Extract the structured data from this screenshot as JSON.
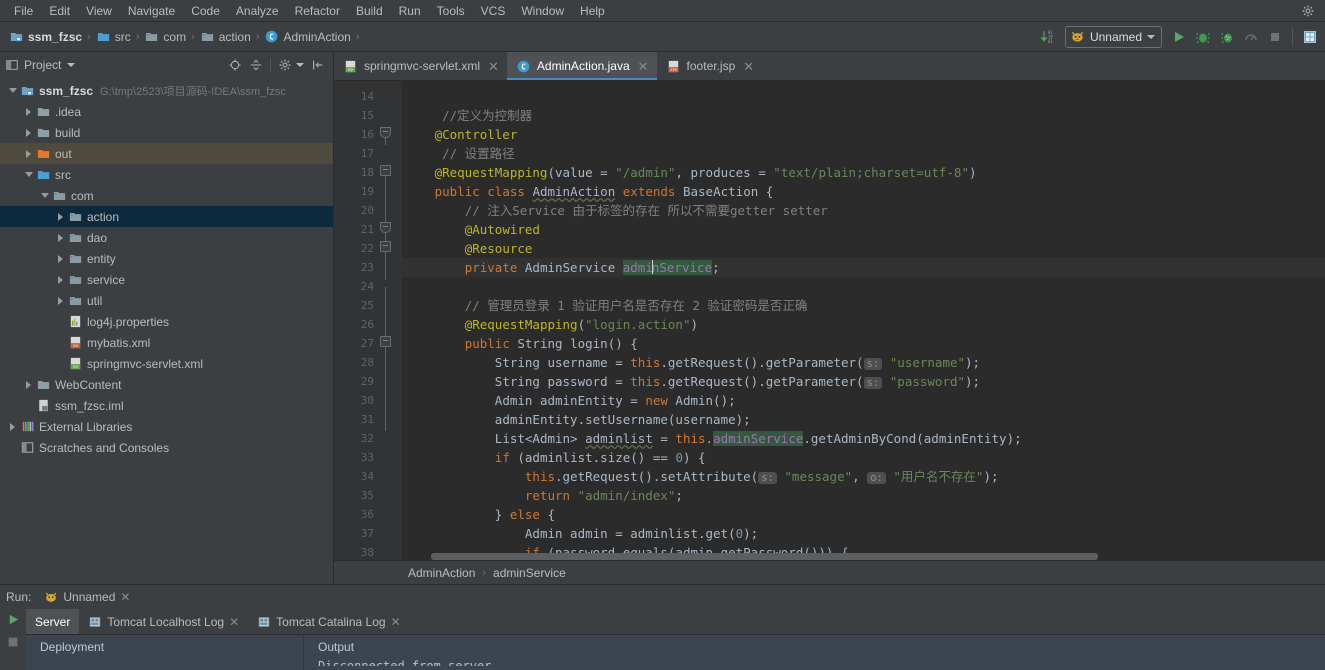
{
  "window": {
    "theme_bg": "#3c3f41",
    "editor_bg": "#2b2b2b",
    "accent": "#4a88c7"
  },
  "menubar": {
    "items": [
      {
        "label": "File"
      },
      {
        "label": "Edit"
      },
      {
        "label": "View"
      },
      {
        "label": "Navigate"
      },
      {
        "label": "Code"
      },
      {
        "label": "Analyze"
      },
      {
        "label": "Refactor"
      },
      {
        "label": "Build"
      },
      {
        "label": "Run"
      },
      {
        "label": "Tools"
      },
      {
        "label": "VCS"
      },
      {
        "label": "Window"
      },
      {
        "label": "Help"
      }
    ]
  },
  "navbar": {
    "crumbs": [
      {
        "label": "ssm_fzsc",
        "icon": "module-icon"
      },
      {
        "label": "src",
        "icon": "source-folder-icon"
      },
      {
        "label": "com",
        "icon": "package-folder-icon"
      },
      {
        "label": "action",
        "icon": "package-folder-icon"
      },
      {
        "label": "AdminAction",
        "icon": "java-class-icon"
      }
    ],
    "separator": "›",
    "run_config": {
      "label": "Unnamed",
      "icon": "tomcat-icon"
    },
    "buttons": [
      {
        "name": "updates-icon",
        "title": "Sync"
      },
      {
        "name": "run-icon",
        "title": "Run"
      },
      {
        "name": "debug-icon",
        "title": "Debug"
      },
      {
        "name": "run-coverage-icon",
        "title": "Run with Coverage"
      },
      {
        "name": "profile-icon",
        "title": "Profile"
      },
      {
        "name": "stop-icon",
        "title": "Stop"
      },
      {
        "name": "database-icon",
        "title": "Database"
      }
    ]
  },
  "project_panel": {
    "title": "Project",
    "tools": [
      {
        "name": "locate-icon"
      },
      {
        "name": "collapse-all-icon"
      },
      {
        "name": "settings-gear-icon"
      },
      {
        "name": "hide-panel-icon"
      }
    ],
    "tree": [
      {
        "label": "ssm_fzsc",
        "path": "G:\\tmp\\2523\\项目源码-IDEA\\ssm_fzsc",
        "indent": 0,
        "arrow": "down",
        "icon": "module-icon",
        "bold": true,
        "state": "normal"
      },
      {
        "label": ".idea",
        "indent": 1,
        "arrow": "right",
        "icon": "folder-icon",
        "state": "normal"
      },
      {
        "label": "build",
        "indent": 1,
        "arrow": "right",
        "icon": "folder-icon",
        "state": "normal"
      },
      {
        "label": "out",
        "indent": 1,
        "arrow": "right",
        "icon": "excluded-folder-icon",
        "state": "highlight"
      },
      {
        "label": "src",
        "indent": 1,
        "arrow": "down",
        "icon": "source-folder-icon",
        "state": "normal"
      },
      {
        "label": "com",
        "indent": 2,
        "arrow": "down",
        "icon": "package-folder-icon",
        "state": "normal"
      },
      {
        "label": "action",
        "indent": 3,
        "arrow": "right",
        "icon": "package-folder-icon",
        "state": "selected"
      },
      {
        "label": "dao",
        "indent": 3,
        "arrow": "right",
        "icon": "package-folder-icon",
        "state": "normal"
      },
      {
        "label": "entity",
        "indent": 3,
        "arrow": "right",
        "icon": "package-folder-icon",
        "state": "normal"
      },
      {
        "label": "service",
        "indent": 3,
        "arrow": "right",
        "icon": "package-folder-icon",
        "state": "normal"
      },
      {
        "label": "util",
        "indent": 3,
        "arrow": "right",
        "icon": "package-folder-icon",
        "state": "normal"
      },
      {
        "label": "log4j.properties",
        "indent": 3,
        "arrow": "none",
        "icon": "properties-file-icon",
        "state": "normal"
      },
      {
        "label": "mybatis.xml",
        "indent": 3,
        "arrow": "none",
        "icon": "xml-file-icon",
        "state": "normal"
      },
      {
        "label": "springmvc-servlet.xml",
        "indent": 3,
        "arrow": "none",
        "icon": "spring-xml-file-icon",
        "state": "normal"
      },
      {
        "label": "WebContent",
        "indent": 1,
        "arrow": "right",
        "icon": "folder-icon",
        "state": "normal"
      },
      {
        "label": "ssm_fzsc.iml",
        "indent": 1,
        "arrow": "none",
        "icon": "iml-file-icon",
        "state": "normal"
      },
      {
        "label": "External Libraries",
        "indent": 0,
        "arrow": "right",
        "icon": "libraries-icon",
        "state": "normal"
      },
      {
        "label": "Scratches and Consoles",
        "indent": 0,
        "arrow": "none",
        "icon": "scratches-icon",
        "state": "normal"
      }
    ]
  },
  "editor": {
    "tabs": [
      {
        "label": "springmvc-servlet.xml",
        "icon": "spring-xml-file-icon",
        "active": false,
        "closable": true
      },
      {
        "label": "AdminAction.java",
        "icon": "java-class-icon",
        "active": true,
        "closable": true
      },
      {
        "label": "footer.jsp",
        "icon": "jsp-file-icon",
        "active": false,
        "closable": true
      }
    ],
    "first_line_number": 14,
    "lines": [
      {
        "n": 14,
        "tokens": []
      },
      {
        "n": 15,
        "tokens": [
          {
            "t": "    ",
            "c": "id"
          },
          {
            "t": "//定义为控制器",
            "c": "cmt"
          }
        ]
      },
      {
        "n": 16,
        "tokens": [
          {
            "t": "   ",
            "c": "id"
          },
          {
            "t": "@Controller",
            "c": "ann"
          }
        ]
      },
      {
        "n": 17,
        "tokens": [
          {
            "t": "    ",
            "c": "id"
          },
          {
            "t": "// 设置路径",
            "c": "cmt"
          }
        ]
      },
      {
        "n": 18,
        "tokens": [
          {
            "t": "   ",
            "c": "id"
          },
          {
            "t": "@RequestMapping",
            "c": "ann"
          },
          {
            "t": "(",
            "c": "id"
          },
          {
            "t": "value",
            "c": "id"
          },
          {
            "t": " = ",
            "c": "id"
          },
          {
            "t": "\"/admin\"",
            "c": "str"
          },
          {
            "t": ", ",
            "c": "id"
          },
          {
            "t": "produces",
            "c": "id"
          },
          {
            "t": " = ",
            "c": "id"
          },
          {
            "t": "\"text/plain;charset=utf-8\"",
            "c": "str"
          },
          {
            "t": ")",
            "c": "id"
          }
        ]
      },
      {
        "n": 19,
        "tokens": [
          {
            "t": "   ",
            "c": "id"
          },
          {
            "t": "public",
            "c": "kw"
          },
          {
            "t": " ",
            "c": "id"
          },
          {
            "t": "class",
            "c": "kw"
          },
          {
            "t": " ",
            "c": "id"
          },
          {
            "t": "AdminAction",
            "c": "id wavy"
          },
          {
            "t": " ",
            "c": "id"
          },
          {
            "t": "extends",
            "c": "kw"
          },
          {
            "t": " ",
            "c": "id"
          },
          {
            "t": "BaseAction",
            "c": "id"
          },
          {
            "t": " {",
            "c": "id"
          }
        ]
      },
      {
        "n": 20,
        "tokens": [
          {
            "t": "       ",
            "c": "id"
          },
          {
            "t": "// 注入Service 由于标签的存在 所以不需要getter setter",
            "c": "cmt"
          }
        ]
      },
      {
        "n": 21,
        "tokens": [
          {
            "t": "       ",
            "c": "id"
          },
          {
            "t": "@Autowired",
            "c": "ann"
          }
        ]
      },
      {
        "n": 22,
        "tokens": [
          {
            "t": "       ",
            "c": "id"
          },
          {
            "t": "@Resource",
            "c": "ann"
          }
        ]
      },
      {
        "n": 23,
        "caret": true,
        "tokens": [
          {
            "t": "       ",
            "c": "id"
          },
          {
            "t": "private",
            "c": "kw"
          },
          {
            "t": " ",
            "c": "id"
          },
          {
            "t": "AdminService",
            "c": "id"
          },
          {
            "t": " ",
            "c": "id"
          },
          {
            "t": "adminService",
            "c": "fld hlg",
            "caret_after": 4
          },
          {
            "t": ";",
            "c": "id"
          }
        ]
      },
      {
        "n": 24,
        "tokens": []
      },
      {
        "n": 25,
        "tokens": [
          {
            "t": "       ",
            "c": "id"
          },
          {
            "t": "// 管理员登录 1 验证用户名是否存在 2 验证密码是否正确",
            "c": "cmt"
          }
        ]
      },
      {
        "n": 26,
        "tokens": [
          {
            "t": "       ",
            "c": "id"
          },
          {
            "t": "@RequestMapping",
            "c": "ann"
          },
          {
            "t": "(",
            "c": "id"
          },
          {
            "t": "\"login.action\"",
            "c": "str"
          },
          {
            "t": ")",
            "c": "id"
          }
        ]
      },
      {
        "n": 27,
        "tokens": [
          {
            "t": "       ",
            "c": "id"
          },
          {
            "t": "public",
            "c": "kw"
          },
          {
            "t": " ",
            "c": "id"
          },
          {
            "t": "String",
            "c": "id"
          },
          {
            "t": " ",
            "c": "id"
          },
          {
            "t": "login",
            "c": "id"
          },
          {
            "t": "() {",
            "c": "id"
          }
        ]
      },
      {
        "n": 28,
        "tokens": [
          {
            "t": "           ",
            "c": "id"
          },
          {
            "t": "String",
            "c": "id"
          },
          {
            "t": " username = ",
            "c": "id"
          },
          {
            "t": "this",
            "c": "kw"
          },
          {
            "t": ".getRequest().getParameter(",
            "c": "id"
          },
          {
            "t": "s:",
            "c": "hint"
          },
          {
            "t": " ",
            "c": "id"
          },
          {
            "t": "\"username\"",
            "c": "str"
          },
          {
            "t": ");",
            "c": "id"
          }
        ]
      },
      {
        "n": 29,
        "tokens": [
          {
            "t": "           ",
            "c": "id"
          },
          {
            "t": "String",
            "c": "id"
          },
          {
            "t": " password = ",
            "c": "id"
          },
          {
            "t": "this",
            "c": "kw"
          },
          {
            "t": ".getRequest().getParameter(",
            "c": "id"
          },
          {
            "t": "s:",
            "c": "hint"
          },
          {
            "t": " ",
            "c": "id"
          },
          {
            "t": "\"password\"",
            "c": "str"
          },
          {
            "t": ");",
            "c": "id"
          }
        ]
      },
      {
        "n": 30,
        "tokens": [
          {
            "t": "           ",
            "c": "id"
          },
          {
            "t": "Admin adminEntity = ",
            "c": "id"
          },
          {
            "t": "new",
            "c": "kw"
          },
          {
            "t": " Admin();",
            "c": "id"
          }
        ]
      },
      {
        "n": 31,
        "tokens": [
          {
            "t": "           ",
            "c": "id"
          },
          {
            "t": "adminEntity.setUsername(username);",
            "c": "id"
          }
        ]
      },
      {
        "n": 32,
        "tokens": [
          {
            "t": "           ",
            "c": "id"
          },
          {
            "t": "List<Admin> ",
            "c": "id"
          },
          {
            "t": "adminlist",
            "c": "id wavy"
          },
          {
            "t": " = ",
            "c": "id"
          },
          {
            "t": "this",
            "c": "kw"
          },
          {
            "t": ".",
            "c": "id"
          },
          {
            "t": "adminService",
            "c": "fld hlg"
          },
          {
            "t": ".getAdminByCond(adminEntity);",
            "c": "id"
          }
        ]
      },
      {
        "n": 33,
        "tokens": [
          {
            "t": "           ",
            "c": "id"
          },
          {
            "t": "if",
            "c": "kw"
          },
          {
            "t": " (adminlist.size() == ",
            "c": "id"
          },
          {
            "t": "0",
            "c": "num"
          },
          {
            "t": ") {",
            "c": "id"
          }
        ]
      },
      {
        "n": 34,
        "tokens": [
          {
            "t": "               ",
            "c": "id"
          },
          {
            "t": "this",
            "c": "kw"
          },
          {
            "t": ".getRequest().setAttribute(",
            "c": "id"
          },
          {
            "t": "s:",
            "c": "hint"
          },
          {
            "t": " ",
            "c": "id"
          },
          {
            "t": "\"message\"",
            "c": "str"
          },
          {
            "t": ", ",
            "c": "id"
          },
          {
            "t": "o:",
            "c": "hint"
          },
          {
            "t": " ",
            "c": "id"
          },
          {
            "t": "\"用户名不存在\"",
            "c": "str"
          },
          {
            "t": ");",
            "c": "id"
          }
        ]
      },
      {
        "n": 35,
        "tokens": [
          {
            "t": "               ",
            "c": "id"
          },
          {
            "t": "return",
            "c": "kw"
          },
          {
            "t": " ",
            "c": "id"
          },
          {
            "t": "\"admin/index\"",
            "c": "str"
          },
          {
            "t": ";",
            "c": "id"
          }
        ]
      },
      {
        "n": 36,
        "tokens": [
          {
            "t": "           ",
            "c": "id"
          },
          {
            "t": "} ",
            "c": "id"
          },
          {
            "t": "else",
            "c": "kw"
          },
          {
            "t": " {",
            "c": "id"
          }
        ]
      },
      {
        "n": 37,
        "tokens": [
          {
            "t": "               ",
            "c": "id"
          },
          {
            "t": "Admin admin = adminlist.get(",
            "c": "id"
          },
          {
            "t": "0",
            "c": "num"
          },
          {
            "t": ");",
            "c": "id"
          }
        ]
      },
      {
        "n": 38,
        "tokens": [
          {
            "t": "               ",
            "c": "id"
          },
          {
            "t": "if",
            "c": "kw"
          },
          {
            "t": " (password.equals(admin.getPassword())) {",
            "c": "id"
          }
        ]
      }
    ],
    "breadcrumb": {
      "items": [
        "AdminAction",
        "adminService"
      ],
      "separator": "›"
    }
  },
  "run_window": {
    "title": "Run:",
    "config_chip": {
      "label": "Unnamed",
      "icon": "tomcat-icon"
    },
    "tabs": [
      {
        "label": "Server",
        "active": true,
        "closable": false,
        "icon": null
      },
      {
        "label": "Tomcat Localhost Log",
        "active": false,
        "closable": true,
        "icon": "log-file-icon"
      },
      {
        "label": "Tomcat Catalina Log",
        "active": false,
        "closable": true,
        "icon": "log-file-icon"
      }
    ],
    "side_buttons": [
      {
        "name": "rerun-icon"
      },
      {
        "name": "stop-icon"
      }
    ],
    "columns": {
      "deployment": "Deployment",
      "output": "Output"
    },
    "output_cut": "Disconnected from server",
    "settings_icon": "gear-icon"
  }
}
